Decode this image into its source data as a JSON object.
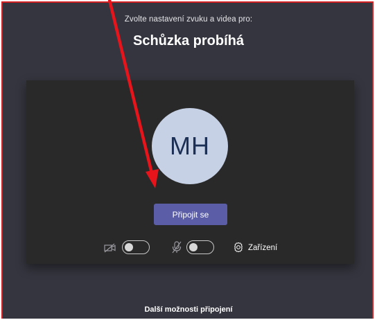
{
  "header": {
    "subtitle": "Zvolte nastavení zvuku a videa pro:",
    "title": "Schůzka probíhá"
  },
  "preview": {
    "avatar_initials": "MH",
    "join_button_label": "Připojit se"
  },
  "controls": {
    "camera": {
      "icon": "camera-off-icon",
      "toggle_on": false
    },
    "microphone": {
      "icon": "microphone-off-icon",
      "toggle_on": false
    },
    "devices": {
      "icon": "gear-icon",
      "label": "Zařízení"
    }
  },
  "footer": {
    "more_options_label": "Další možnosti připojení"
  },
  "annotation": {
    "icon": "red-arrow-annotation",
    "color": "#e8141b"
  },
  "colors": {
    "background": "#35353f",
    "preview": "#292929",
    "accent": "#5b5ea6",
    "avatar": "#c6d1e6",
    "border": "#d42020"
  }
}
